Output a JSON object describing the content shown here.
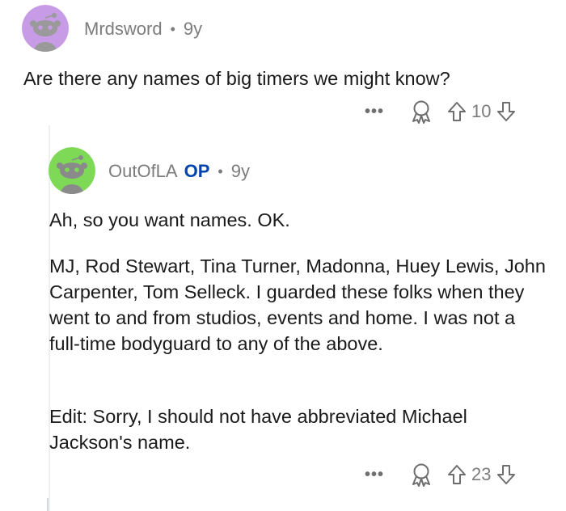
{
  "comment_parent": {
    "username": "Mrdsword",
    "separator": "•",
    "age": "9y",
    "text": "Are there any names of big timers we might know?",
    "more_label": "•••",
    "vote_count": "10",
    "avatar_color": "#c89be6"
  },
  "comment_reply": {
    "username": "OutOfLA",
    "op_badge": "OP",
    "separator": "•",
    "age": "9y",
    "paragraph_1": "Ah, so you want names. OK.",
    "paragraph_2": "MJ, Rod Stewart, Tina Turner, Madonna, Huey Lewis, John Carpenter, Tom Selleck. I guarded these folks when they went to and from studios, events and home. I was not a full-time bodyguard to any of the above.",
    "paragraph_3": "Edit: Sorry, I should not have abbreviated Michael Jackson's name.",
    "more_label": "•••",
    "vote_count": "23",
    "avatar_color": "#7ed957"
  },
  "icons": {
    "more": "more-options-icon",
    "award": "award-icon",
    "upvote": "upvote-arrow-icon",
    "downvote": "downvote-arrow-icon"
  },
  "colors": {
    "op_blue": "#0045ac",
    "muted_text": "#7c7c7c",
    "body_text": "#1a1a1b"
  }
}
